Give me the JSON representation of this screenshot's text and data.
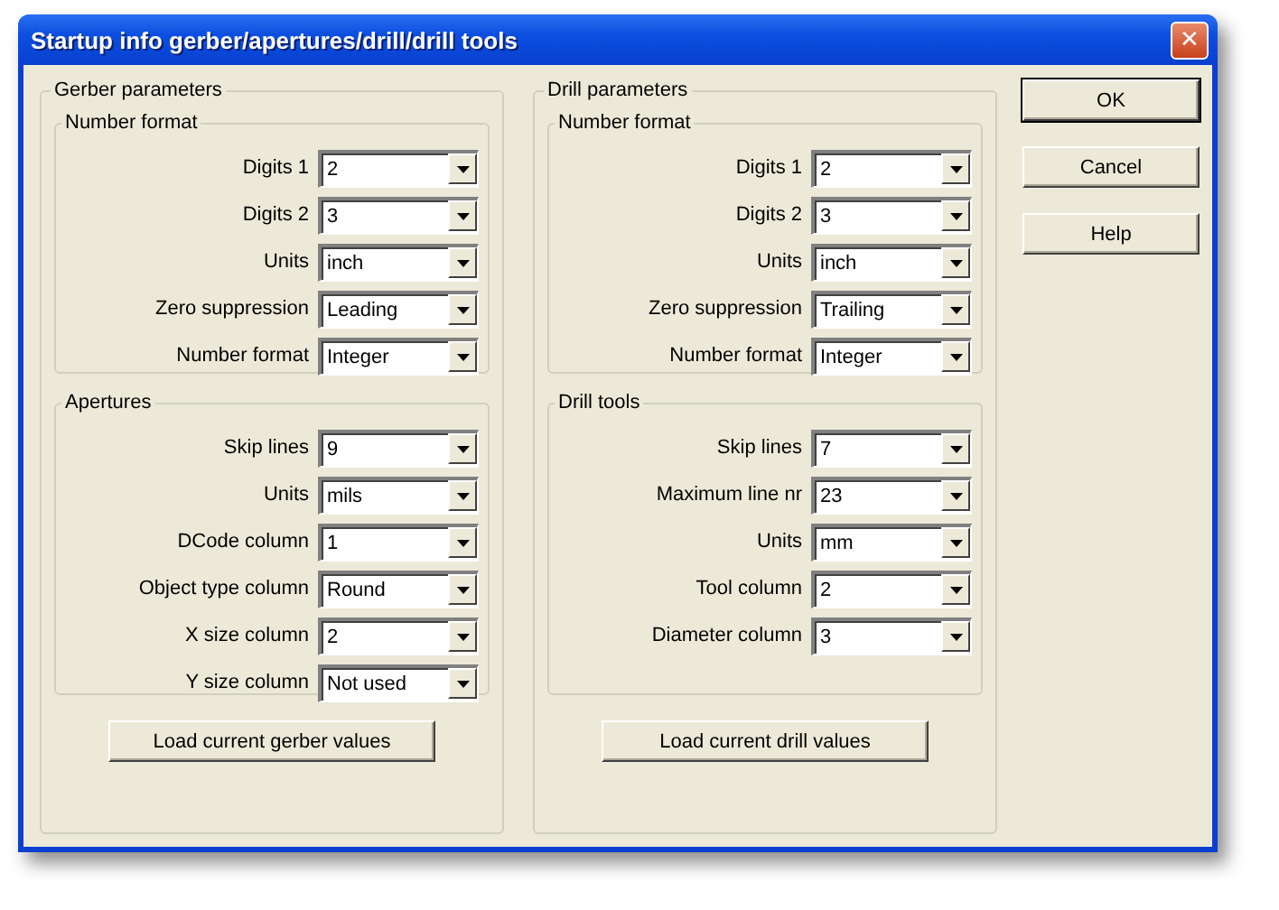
{
  "window": {
    "title": "Startup info gerber/apertures/drill/drill tools",
    "close_glyph": "✕"
  },
  "panels": [
    {
      "title": "Gerber parameters",
      "groups": [
        {
          "title": "Number format",
          "fields": [
            {
              "label": "Digits 1",
              "value": "2"
            },
            {
              "label": "Digits 2",
              "value": "3"
            },
            {
              "label": "Units",
              "value": "inch"
            },
            {
              "label": "Zero suppression",
              "value": "Leading"
            },
            {
              "label": "Number format",
              "value": "Integer"
            }
          ]
        },
        {
          "title": "Apertures",
          "fields": [
            {
              "label": "Skip lines",
              "value": "9"
            },
            {
              "label": "Units",
              "value": "mils"
            },
            {
              "label": "DCode column",
              "value": "1"
            },
            {
              "label": "Object type column",
              "value": "Round"
            },
            {
              "label": "X size column",
              "value": "2"
            },
            {
              "label": "Y size column",
              "value": "Not used"
            }
          ]
        }
      ],
      "button": "Load current gerber values"
    },
    {
      "title": "Drill parameters",
      "groups": [
        {
          "title": "Number format",
          "fields": [
            {
              "label": "Digits 1",
              "value": "2"
            },
            {
              "label": "Digits 2",
              "value": "3"
            },
            {
              "label": "Units",
              "value": "inch"
            },
            {
              "label": "Zero suppression",
              "value": "Trailing"
            },
            {
              "label": "Number format",
              "value": "Integer"
            }
          ]
        },
        {
          "title": "Drill tools",
          "fields": [
            {
              "label": "Skip lines",
              "value": "7"
            },
            {
              "label": "Maximum line nr",
              "value": "23"
            },
            {
              "label": "Units",
              "value": "mm"
            },
            {
              "label": "Tool column",
              "value": "2"
            },
            {
              "label": "Diameter column",
              "value": "3"
            }
          ]
        }
      ],
      "button": "Load current drill values"
    }
  ],
  "buttons": [
    {
      "label": "OK",
      "default": true
    },
    {
      "label": "Cancel",
      "default": false
    },
    {
      "label": "Help",
      "default": false
    }
  ]
}
